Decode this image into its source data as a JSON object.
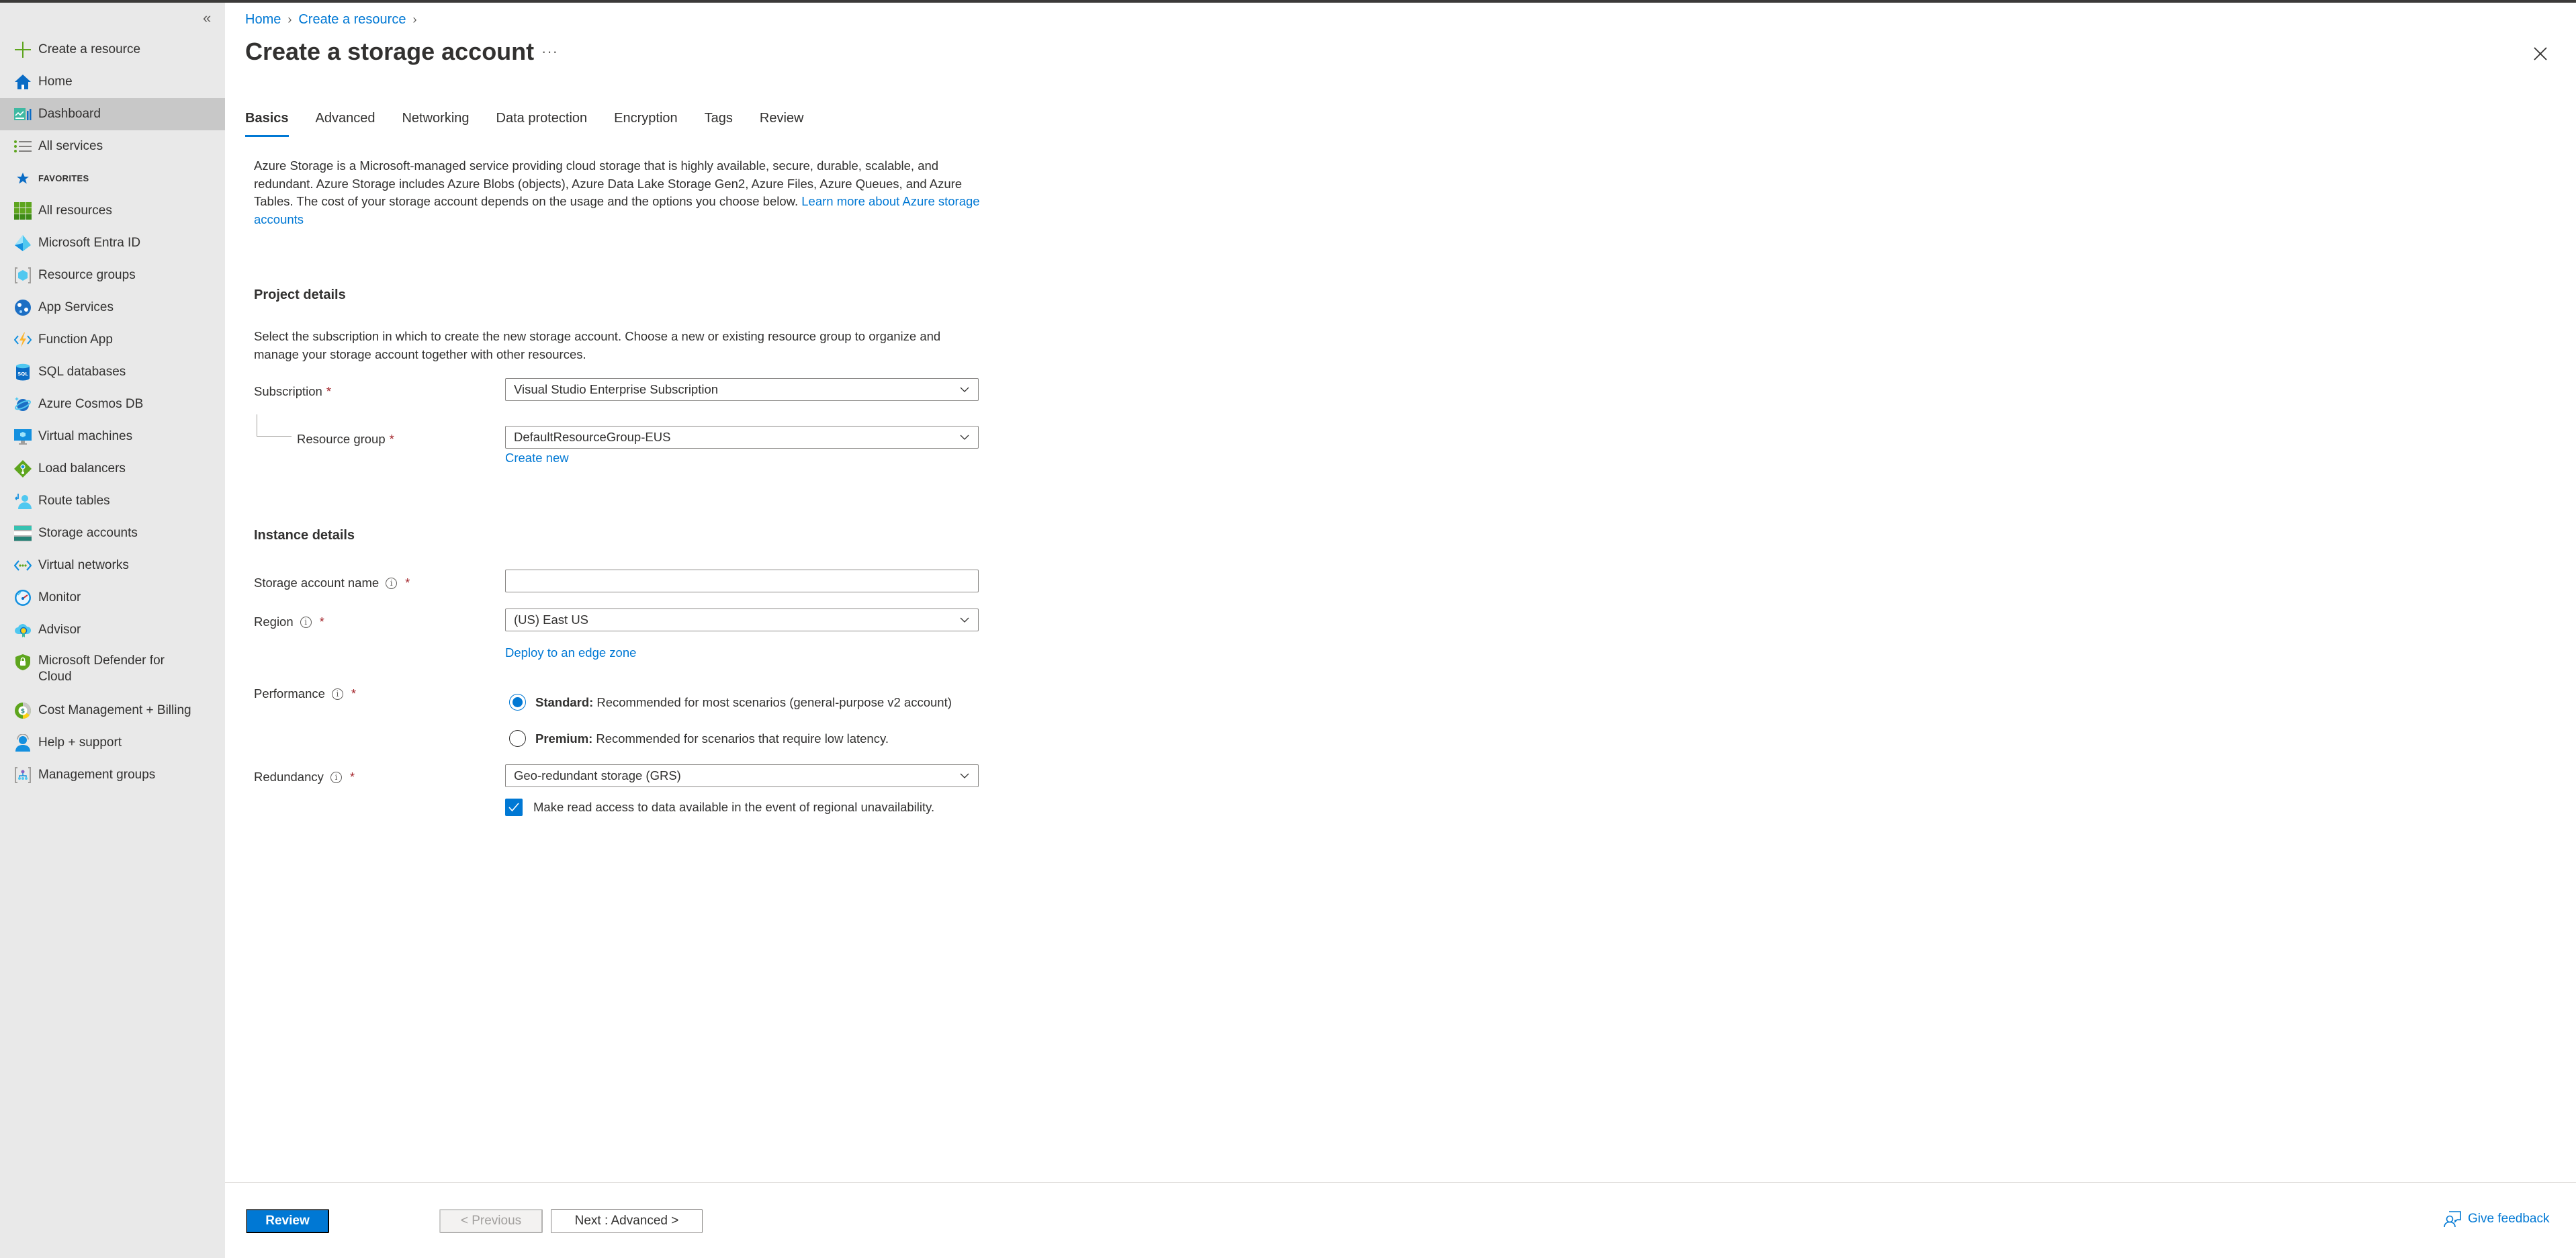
{
  "sidebar": {
    "collapse_label": "«",
    "items": [
      {
        "label": "Create a resource",
        "icon": "plus-icon"
      },
      {
        "label": "Home",
        "icon": "home-icon"
      },
      {
        "label": "Dashboard",
        "icon": "dashboard-icon",
        "selected": true
      },
      {
        "label": "All services",
        "icon": "list-icon"
      },
      {
        "label": "FAVORITES",
        "icon": "star-icon"
      },
      {
        "label": "All resources",
        "icon": "grid-icon"
      },
      {
        "label": "Microsoft Entra ID",
        "icon": "entra-id-icon"
      },
      {
        "label": "Resource groups",
        "icon": "resource-group-icon"
      },
      {
        "label": "App Services",
        "icon": "app-services-icon"
      },
      {
        "label": "Function App",
        "icon": "function-app-icon"
      },
      {
        "label": "SQL databases",
        "icon": "sql-database-icon"
      },
      {
        "label": "Azure Cosmos DB",
        "icon": "cosmos-db-icon"
      },
      {
        "label": "Virtual machines",
        "icon": "virtual-machine-icon"
      },
      {
        "label": "Load balancers",
        "icon": "load-balancer-icon"
      },
      {
        "label": "Route tables",
        "icon": "route-table-icon"
      },
      {
        "label": "Storage accounts",
        "icon": "storage-account-icon"
      },
      {
        "label": "Virtual networks",
        "icon": "virtual-network-icon"
      },
      {
        "label": "Monitor",
        "icon": "monitor-icon"
      },
      {
        "label": "Advisor",
        "icon": "advisor-icon"
      },
      {
        "label": "Microsoft Defender for Cloud",
        "icon": "defender-icon"
      },
      {
        "label": "Cost Management + Billing",
        "icon": "cost-management-icon"
      },
      {
        "label": "Help + support",
        "icon": "help-support-icon"
      },
      {
        "label": "Management groups",
        "icon": "management-groups-icon"
      }
    ]
  },
  "breadcrumb": [
    {
      "label": "Home"
    },
    {
      "label": "Create a resource"
    }
  ],
  "page": {
    "title": "Create a storage account",
    "more_label": "···"
  },
  "tabs": [
    {
      "label": "Basics",
      "active": true
    },
    {
      "label": "Advanced"
    },
    {
      "label": "Networking"
    },
    {
      "label": "Data protection"
    },
    {
      "label": "Encryption"
    },
    {
      "label": "Tags"
    },
    {
      "label": "Review"
    }
  ],
  "intro": {
    "text": "Azure Storage is a Microsoft-managed service providing cloud storage that is highly available, secure, durable, scalable, and redundant. Azure Storage includes Azure Blobs (objects), Azure Data Lake Storage Gen2, Azure Files, Azure Queues, and Azure Tables. The cost of your storage account depends on the usage and the options you choose below.",
    "link": "Learn more about Azure storage accounts"
  },
  "project_details": {
    "heading": "Project details",
    "description": "Select the subscription in which to create the new storage account. Choose a new or existing resource group to organize and manage your storage account together with other resources.",
    "subscription": {
      "label": "Subscription",
      "value": "Visual Studio Enterprise Subscription"
    },
    "resource_group": {
      "label": "Resource group",
      "value": "DefaultResourceGroup-EUS",
      "create_new": "Create new"
    }
  },
  "instance_details": {
    "heading": "Instance details",
    "storage_account_name": {
      "label": "Storage account name",
      "value": "",
      "placeholder": ""
    },
    "region": {
      "label": "Region",
      "value": "(US) East US",
      "edge_zone_link": "Deploy to an edge zone"
    },
    "performance": {
      "label": "Performance",
      "options": [
        {
          "title": "Standard:",
          "text": "Recommended for most scenarios (general-purpose v2 account)",
          "selected": true
        },
        {
          "title": "Premium:",
          "text": "Recommended for scenarios that require low latency.",
          "selected": false
        }
      ]
    },
    "redundancy": {
      "label": "Redundancy",
      "value": "Geo-redundant storage (GRS)",
      "read_access": {
        "label": "Make read access to data available in the event of regional unavailability.",
        "checked": true
      }
    }
  },
  "required_marker": "*",
  "info_glyph": "i",
  "footer": {
    "review": "Review",
    "previous": "< Previous",
    "next": "Next : Advanced >",
    "feedback": "Give feedback"
  },
  "colors": {
    "accent": "#0078d4",
    "required": "#a4262c",
    "sidebar_bg": "#e9e9e9",
    "sidebar_selected": "#c8c8c8"
  }
}
